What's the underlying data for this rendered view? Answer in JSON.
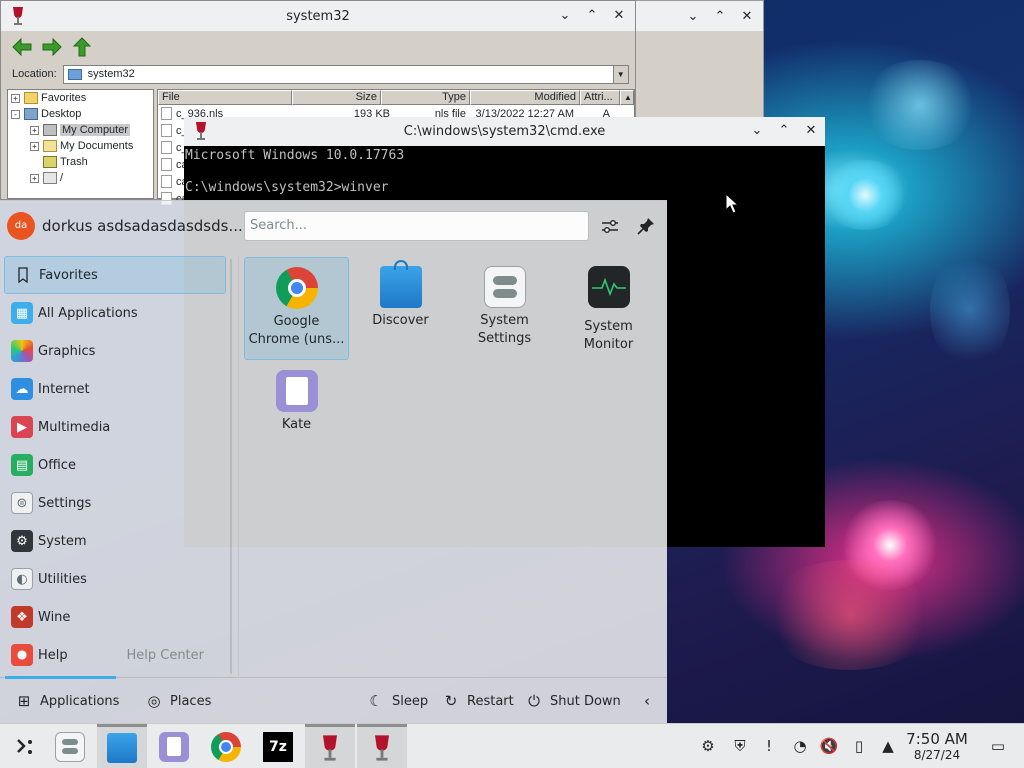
{
  "explorer": {
    "title": "system32",
    "controls": [
      "⌄",
      "⌃",
      "✕"
    ],
    "location_label": "Location:",
    "location_value": "system32",
    "tree": [
      {
        "label": "Favorites",
        "toggle": "+"
      },
      {
        "label": "Desktop",
        "toggle": "-"
      },
      {
        "label": "My Computer",
        "toggle": "+"
      },
      {
        "label": "My Documents",
        "toggle": "+"
      },
      {
        "label": "Trash",
        "toggle": ""
      },
      {
        "label": "/",
        "toggle": "+"
      }
    ],
    "columns": [
      "File",
      "Size",
      "Type",
      "Modified",
      "Attri..."
    ],
    "rows": [
      {
        "file": "c_936.nls",
        "size": "193 KB",
        "type": "nls file",
        "modified": "3/13/2022 12:27 AM",
        "attr": "A"
      },
      {
        "file": "c_"
      },
      {
        "file": "c_"
      },
      {
        "file": "ca"
      },
      {
        "file": "ca"
      },
      {
        "file": "ca"
      }
    ]
  },
  "back_window": {
    "controls": [
      "⌄",
      "⌃",
      "✕"
    ]
  },
  "cmd": {
    "title": "C:\\windows\\system32\\cmd.exe",
    "controls": [
      "⌄",
      "⌃",
      "✕"
    ],
    "line1": "Microsoft Windows 10.0.17763",
    "line2": "C:\\windows\\system32>winver"
  },
  "menu": {
    "avatar_initials": "da",
    "user_name": "dorkus asdsadasdasdsds...",
    "search_placeholder": "Search...",
    "configure_icon": "sliders-icon",
    "pin_icon": "pin-icon",
    "categories": [
      {
        "label": "Favorites",
        "icon": "bookmark-icon",
        "color": "#ffffff"
      },
      {
        "label": "All Applications",
        "icon": "grid-icon",
        "color": "#3daee9"
      },
      {
        "label": "Graphics",
        "icon": "palette-icon",
        "color": "#d6437c"
      },
      {
        "label": "Internet",
        "icon": "cloud-icon",
        "color": "#2e8ee0"
      },
      {
        "label": "Multimedia",
        "icon": "play-icon",
        "color": "#da4453"
      },
      {
        "label": "Office",
        "icon": "document-icon",
        "color": "#27ae60"
      },
      {
        "label": "Settings",
        "icon": "toggle-icon",
        "color": "#5f6b72"
      },
      {
        "label": "System",
        "icon": "gear-icon",
        "color": "#31363b"
      },
      {
        "label": "Utilities",
        "icon": "utilities-icon",
        "color": "#7f8c8d"
      },
      {
        "label": "Wine",
        "icon": "wine-icon",
        "color": "#c0392b"
      },
      {
        "label": "Help",
        "icon": "lifebuoy-icon",
        "color": "#e74c3c",
        "side": "Help Center"
      }
    ],
    "apps": [
      {
        "line1": "Google",
        "line2": "Chrome (uns...",
        "icon": "chrome-icon"
      },
      {
        "line1": "Discover",
        "line2": "",
        "icon": "discover-icon"
      },
      {
        "line1": "System",
        "line2": "Settings",
        "icon": "system-settings-icon"
      },
      {
        "line1": "System",
        "line2": "Monitor",
        "icon": "system-monitor-icon"
      },
      {
        "line1": "Kate",
        "line2": "",
        "icon": "kate-icon"
      }
    ],
    "footer": {
      "applications": "Applications",
      "places": "Places",
      "sleep": "Sleep",
      "restart": "Restart",
      "shutdown": "Shut Down"
    }
  },
  "panel": {
    "time": "7:50 AM",
    "date": "8/27/24"
  }
}
